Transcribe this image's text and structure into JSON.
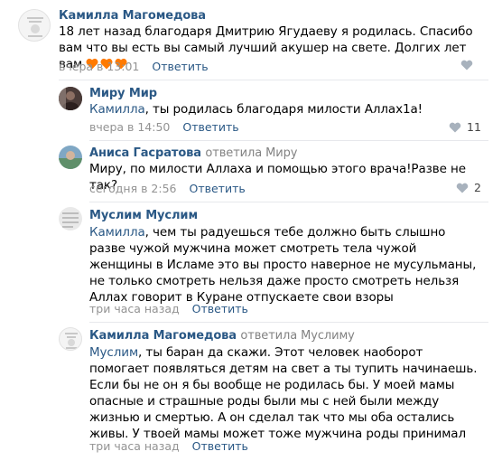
{
  "comments": [
    {
      "author": "Камилла Магомедова",
      "reply_to": "",
      "addressee": "",
      "text": "18 лет назад благодаря Дмитрию Ягудаеву я родилась. Спасибо вам что вы есть вы самый лучший акушер на свете. Долгих лет вам",
      "emoji": [
        "heart-emoji",
        "heart-emoji",
        "heart-emoji"
      ],
      "time": "вчера в 13:01",
      "reply_label": "Ответить",
      "likes": ""
    },
    {
      "author": "Миру Мир",
      "reply_to": "",
      "addressee": "Камилла",
      "text": ", ты родилась благодаря милости Аллах1а!",
      "time": "вчера в 14:50",
      "reply_label": "Ответить",
      "likes": "11"
    },
    {
      "author": "Аниса Гасратова",
      "reply_to": "ответила Миру",
      "addressee": "Миру",
      "text": ", по милости Аллаха и помощью этого врача!Разве не так?",
      "time": "сегодня в 2:56",
      "reply_label": "Ответить",
      "likes": "2"
    },
    {
      "author": "Муслим Муслим",
      "reply_to": "",
      "addressee": "Камилла",
      "text": ", чем ты радуешься тебе должно быть слышно разве чужой мужчина может смотреть тела чужой женщины в Исламе это вы просто наверное не мусульманы, не только смотреть нельзя даже просто смотреть нельзя Аллах говорит в Куране отпускаете свои взоры",
      "time": "три часа назад",
      "reply_label": "Ответить",
      "likes": ""
    },
    {
      "author": "Камилла Магомедова",
      "reply_to": "ответила Муслиму",
      "addressee": "Муслим",
      "text": ", ты баран да скажи. Этот человек наоборот помогает появляться детям на свет а ты тупить начинаешь. Если бы не он я бы вообще не родилась бы. У моей мамы опасные и страшные роды были мы с ней были между жизнью и смертью. А он сделал так что мы оба остались живы. У твоей мамы может тоже мужчина роды принимал",
      "time": "три часа назад",
      "reply_label": "Ответить",
      "likes": ""
    }
  ],
  "colors": {
    "link": "#2a5885",
    "muted": "#939393",
    "heart": "#ff7a00"
  }
}
